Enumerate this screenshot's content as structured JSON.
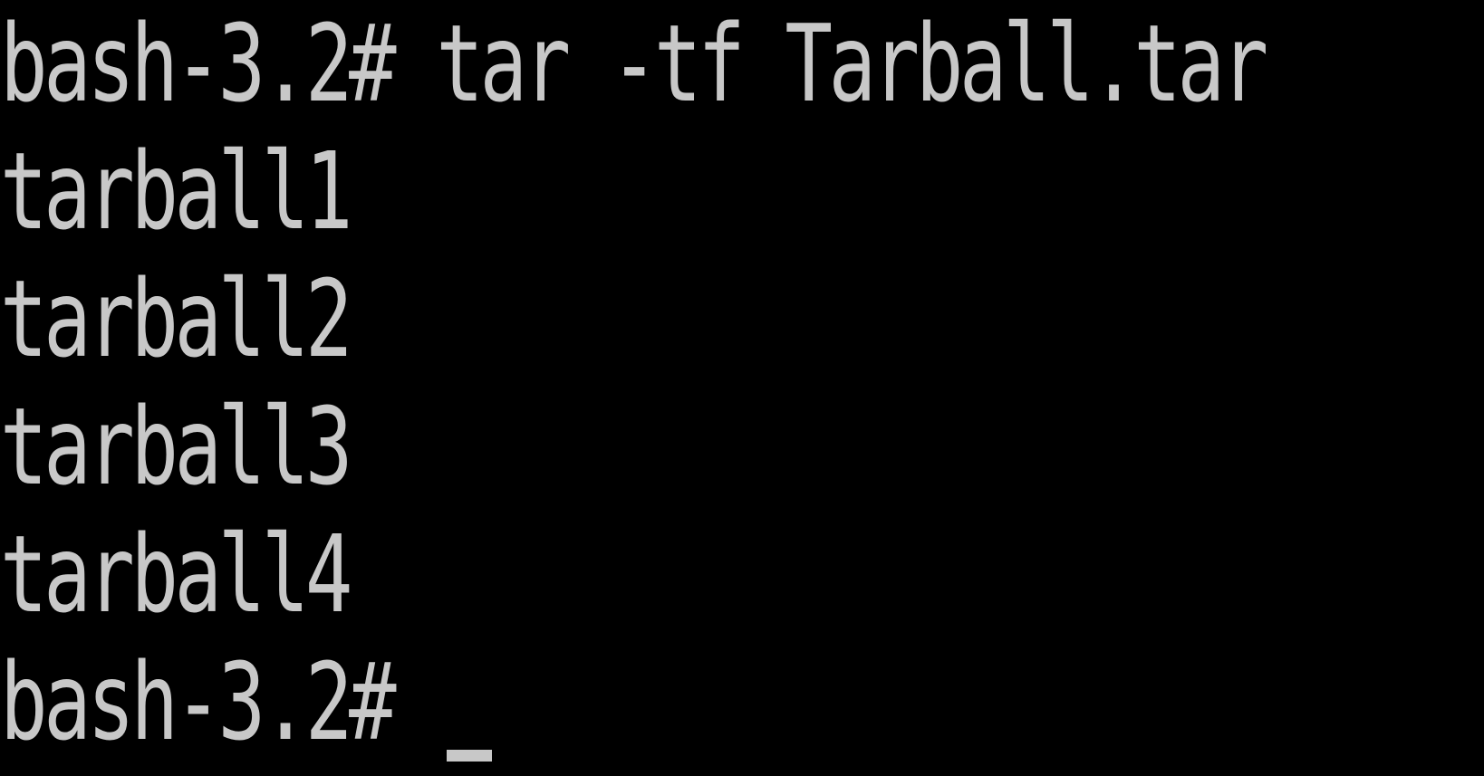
{
  "terminal": {
    "lines": [
      {
        "prompt": "bash-3.2#",
        "command": " tar -tf Tarball.tar"
      },
      {
        "output": "tarball1"
      },
      {
        "output": "tarball2"
      },
      {
        "output": "tarball3"
      },
      {
        "output": "tarball4"
      },
      {
        "prompt": "bash-3.2#",
        "command": " "
      }
    ],
    "colors": {
      "background": "#000000",
      "foreground": "#c8c8c8"
    }
  }
}
